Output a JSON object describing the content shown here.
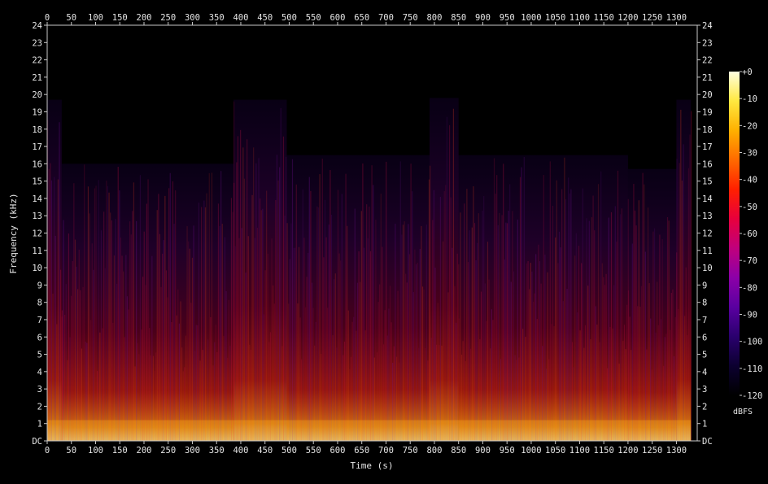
{
  "chart_data": {
    "type": "heatmap",
    "title": "",
    "xlabel": "Time (s)",
    "ylabel": "Frequency (kHz)",
    "xlim": [
      0,
      1343
    ],
    "ylim": [
      0,
      24
    ],
    "x_ticks": [
      0,
      50,
      100,
      150,
      200,
      250,
      300,
      350,
      400,
      450,
      500,
      550,
      600,
      650,
      700,
      750,
      800,
      850,
      900,
      950,
      1000,
      1050,
      1100,
      1150,
      1200,
      1250,
      1300
    ],
    "y_ticks": [
      "DC",
      "1",
      "2",
      "3",
      "4",
      "5",
      "6",
      "7",
      "8",
      "9",
      "10",
      "11",
      "12",
      "13",
      "14",
      "15",
      "16",
      "17",
      "18",
      "19",
      "20",
      "21",
      "22",
      "23",
      "24"
    ],
    "colorbar": {
      "label": "dBFS",
      "ticks": [
        "+0",
        "-10",
        "-20",
        "-30",
        "-40",
        "-50",
        "-60",
        "-70",
        "-80",
        "-90",
        "-100",
        "-110",
        "-120"
      ],
      "range": [
        -120,
        0
      ],
      "colormap": [
        "#000000",
        "#0c0030",
        "#2a006e",
        "#5a00a0",
        "#8c00a8",
        "#c0007c",
        "#e8003c",
        "#ff2000",
        "#ff6a00",
        "#ffb000",
        "#ffe840",
        "#ffffe0"
      ]
    },
    "content_cutoff_khz": [
      {
        "t_start": 0,
        "t_end": 30,
        "cutoff_khz": 19.7
      },
      {
        "t_start": 30,
        "t_end": 385,
        "cutoff_khz": 16
      },
      {
        "t_start": 385,
        "t_end": 495,
        "cutoff_khz": 19.7
      },
      {
        "t_start": 495,
        "t_end": 790,
        "cutoff_khz": 16.5
      },
      {
        "t_start": 790,
        "t_end": 850,
        "cutoff_khz": 19.8
      },
      {
        "t_start": 850,
        "t_end": 1200,
        "cutoff_khz": 16.5
      },
      {
        "t_start": 1200,
        "t_end": 1300,
        "cutoff_khz": 15.7
      },
      {
        "t_start": 1300,
        "t_end": 1330,
        "cutoff_khz": 19.7
      },
      {
        "t_start": 1330,
        "t_end": 1343,
        "cutoff_khz": 0
      }
    ]
  },
  "colors": {
    "background": "#000000",
    "axis": "#c8c8c8",
    "text": "#e6e6e6"
  }
}
